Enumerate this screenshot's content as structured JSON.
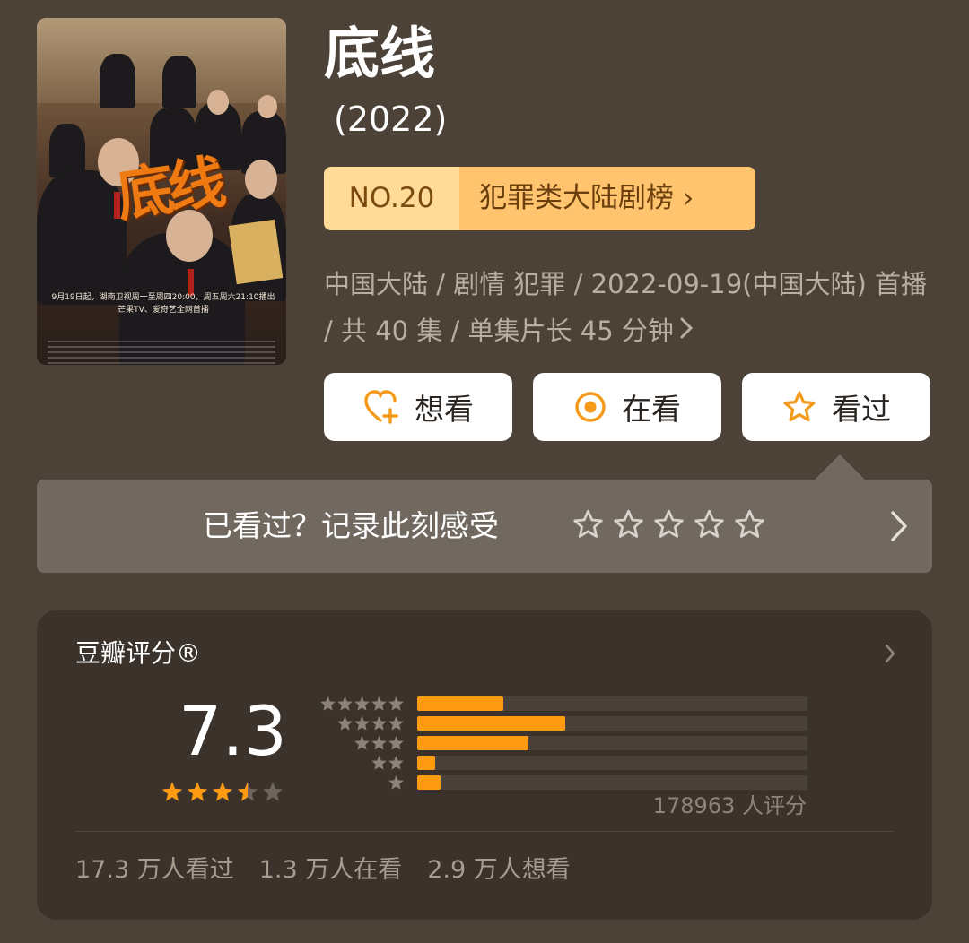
{
  "poster": {
    "title_art": "底线",
    "caption": "9月19日起，湖南卫视周一至周四20:00，周五周六21:10播出 芒果TV、爱奇艺全网首播"
  },
  "title": "底线",
  "year": "(2022)",
  "rank": {
    "number": "NO.20",
    "label": "犯罪类大陆剧榜 ›"
  },
  "meta": {
    "line": "中国大陆 / 剧情 犯罪 / 2022-09-19(中国大陆) 首播 / 共 40 集 / 单集片长 45 分钟"
  },
  "actions": {
    "want": "想看",
    "watching": "在看",
    "watched": "看过"
  },
  "record": {
    "prompt": "已看过？记录此刻感受"
  },
  "rating": {
    "label": "豆瓣评分®",
    "score": "7.3",
    "star_value": 3.5,
    "distribution": [
      {
        "stars": 5,
        "fraction": 0.22
      },
      {
        "stars": 4,
        "fraction": 0.38
      },
      {
        "stars": 3,
        "fraction": 0.285
      },
      {
        "stars": 2,
        "fraction": 0.045
      },
      {
        "stars": 1,
        "fraction": 0.06
      }
    ],
    "count": "178963 人评分"
  },
  "stats": {
    "watched": "17.3 万人看过",
    "watching": "1.3 万人在看",
    "want": "2.9 万人想看"
  },
  "colors": {
    "background": "#4d4237",
    "card": "#3a322b",
    "accent": "#ff9b12",
    "rank_no_bg": "#ffdb97",
    "rank_label_bg": "#ffc46d"
  }
}
